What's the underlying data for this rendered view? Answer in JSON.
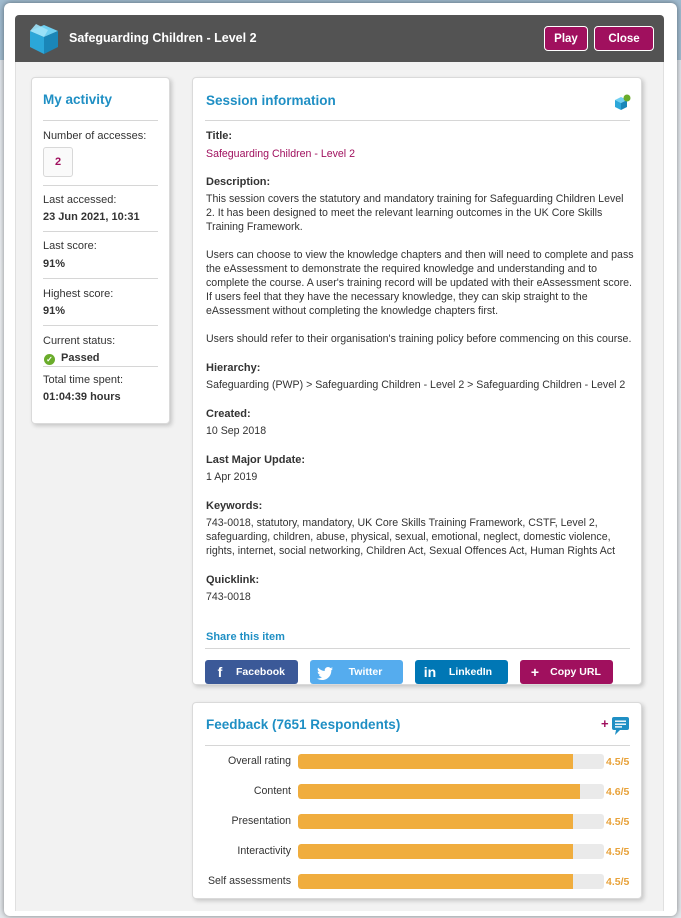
{
  "modal": {
    "title": "Safeguarding Children - Level 2",
    "play_label": "Play",
    "close_label": "Close"
  },
  "activity": {
    "title": "My activity",
    "accesses_label": "Number of accesses:",
    "accesses_value": "2",
    "last_accessed_label": "Last accessed:",
    "last_accessed_value": "23 Jun 2021, 10:31",
    "last_score_label": "Last score:",
    "last_score_value": "91%",
    "highest_score_label": "Highest score:",
    "highest_score_value": "91%",
    "status_label": "Current status:",
    "status_value": "Passed",
    "time_label": "Total time spent:",
    "time_value": "01:04:39 hours"
  },
  "session": {
    "title": "Session information",
    "title_label": "Title:",
    "title_value": "Safeguarding Children - Level 2",
    "description_label": "Description:",
    "description_p1": "This session covers the statutory and mandatory training for Safeguarding Children Level 2. It has been designed to meet the relevant learning outcomes in the UK Core Skills Training Framework.",
    "description_p2": "Users can choose to view the knowledge chapters and then will need to complete and pass the eAssessment to demonstrate the required knowledge and understanding and to complete the course. A user's training record will be updated with their eAssessment score. If users feel that they have the necessary knowledge, they can skip straight to the eAssessment without completing the knowledge chapters first.",
    "description_p3": "Users should refer to their organisation's training policy before commencing on this course.",
    "hierarchy_label": "Hierarchy:",
    "hierarchy_value": "Safeguarding (PWP) > Safeguarding Children - Level 2 > Safeguarding Children - Level 2",
    "created_label": "Created:",
    "created_value": "10 Sep 2018",
    "update_label": "Last Major Update:",
    "update_value": "1 Apr 2019",
    "keywords_label": "Keywords:",
    "keywords_value": "743-0018, statutory, mandatory, UK Core Skills Training Framework, CSTF, Level 2, safeguarding, children, abuse, physical, sexual, emotional, neglect, domestic violence, rights, internet, social networking, Children Act, Sexual Offences Act, Human Rights Act",
    "quicklink_label": "Quicklink:",
    "quicklink_value": "743-0018",
    "share_label": "Share this item",
    "share": {
      "facebook": "Facebook",
      "twitter": "Twitter",
      "linkedin": "LinkedIn",
      "copy_url": "Copy URL"
    }
  },
  "feedback": {
    "title": "Feedback (7651 Respondents)",
    "rows": [
      {
        "label": "Overall rating",
        "score": "4.5/5",
        "fraction": 0.9
      },
      {
        "label": "Content",
        "score": "4.6/5",
        "fraction": 0.92
      },
      {
        "label": "Presentation",
        "score": "4.5/5",
        "fraction": 0.9
      },
      {
        "label": "Interactivity",
        "score": "4.5/5",
        "fraction": 0.9
      },
      {
        "label": "Self assessments",
        "score": "4.5/5",
        "fraction": 0.9
      }
    ]
  },
  "colors": {
    "accent_blue": "#1f8fc4",
    "brand_magenta": "#a0105e",
    "rating_orange": "#f0ad3e",
    "header_grey": "#535353"
  }
}
